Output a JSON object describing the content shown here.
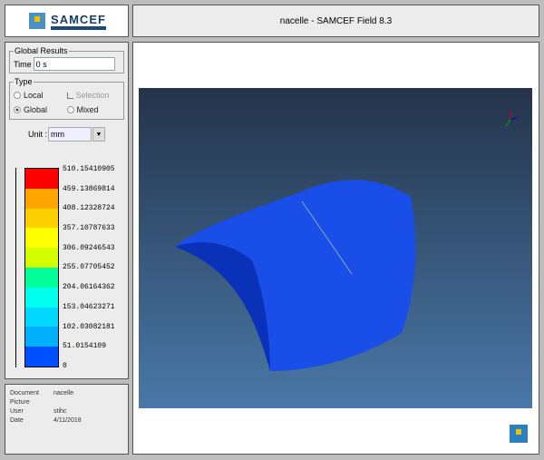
{
  "logo": {
    "text": "SAMCEF"
  },
  "title": "nacelle - SAMCEF Field 8.3",
  "results": {
    "group": "Global Results",
    "time_label": "Time",
    "time_value": "0 s"
  },
  "type": {
    "group": "Type",
    "local": "Local",
    "selection": "Selection",
    "global": "Global",
    "mixed": "Mixed",
    "selected": "Global"
  },
  "unit": {
    "label": "Unit :",
    "value": "mm"
  },
  "legend": {
    "colors": [
      "#ff0000",
      "#ffa500",
      "#ffd000",
      "#ffff00",
      "#d4ff00",
      "#00ff99",
      "#00ffee",
      "#00d8ff",
      "#00b0ff",
      "#0050ff"
    ],
    "labels": [
      "510.15410905",
      "459.13869814",
      "408.12328724",
      "357.10787633",
      "306.09246543",
      "255.07705452",
      "204.06164362",
      "153.04623271",
      "102.03082181",
      "51.0154109",
      "0"
    ]
  },
  "info": {
    "rows": [
      {
        "k": "Document",
        "v": "nacelle"
      },
      {
        "k": "Picture",
        "v": ""
      },
      {
        "k": "User",
        "v": "stihc"
      },
      {
        "k": "Date",
        "v": "4/11/2018"
      }
    ]
  }
}
